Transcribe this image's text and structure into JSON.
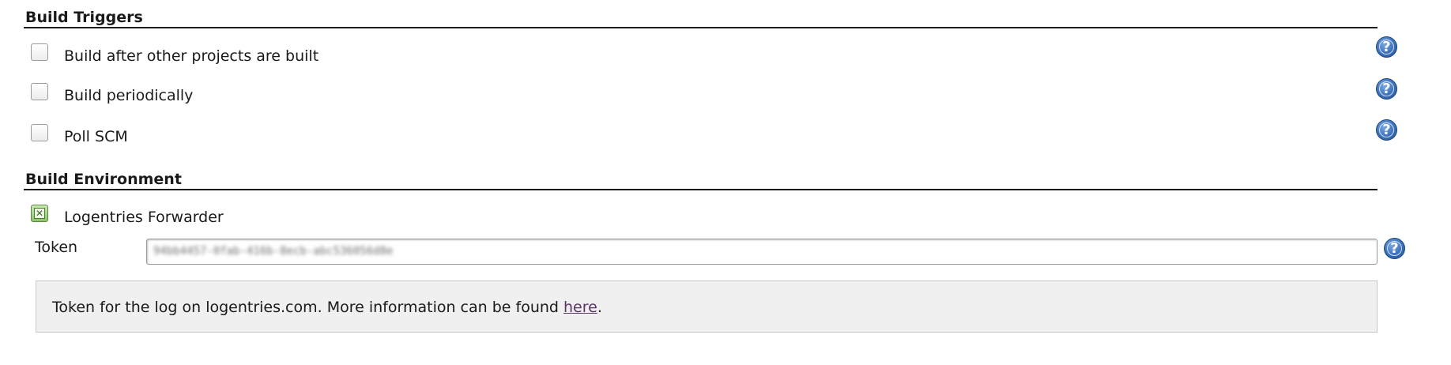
{
  "build_triggers": {
    "title": "Build Triggers",
    "options": [
      {
        "label": "Build after other projects are built",
        "checked": false
      },
      {
        "label": "Build periodically",
        "checked": false
      },
      {
        "label": "Poll SCM",
        "checked": false
      }
    ]
  },
  "build_environment": {
    "title": "Build Environment",
    "logentries": {
      "label": "Logentries Forwarder",
      "checked": true
    },
    "token": {
      "label": "Token",
      "value": "94bb4457-0fab-416b-8ecb-abc536056d8e"
    },
    "info": {
      "text_before": "Token for the log on logentries.com. More information can be found ",
      "link_text": "here",
      "text_after": "."
    }
  },
  "icons": {
    "help": "help-question-icon",
    "help_glyph": "?"
  },
  "colors": {
    "help_blue": "#3a6fba",
    "checked_green": "#8cc56a",
    "info_bg": "#f0f0f0",
    "link": "#5c3566"
  }
}
